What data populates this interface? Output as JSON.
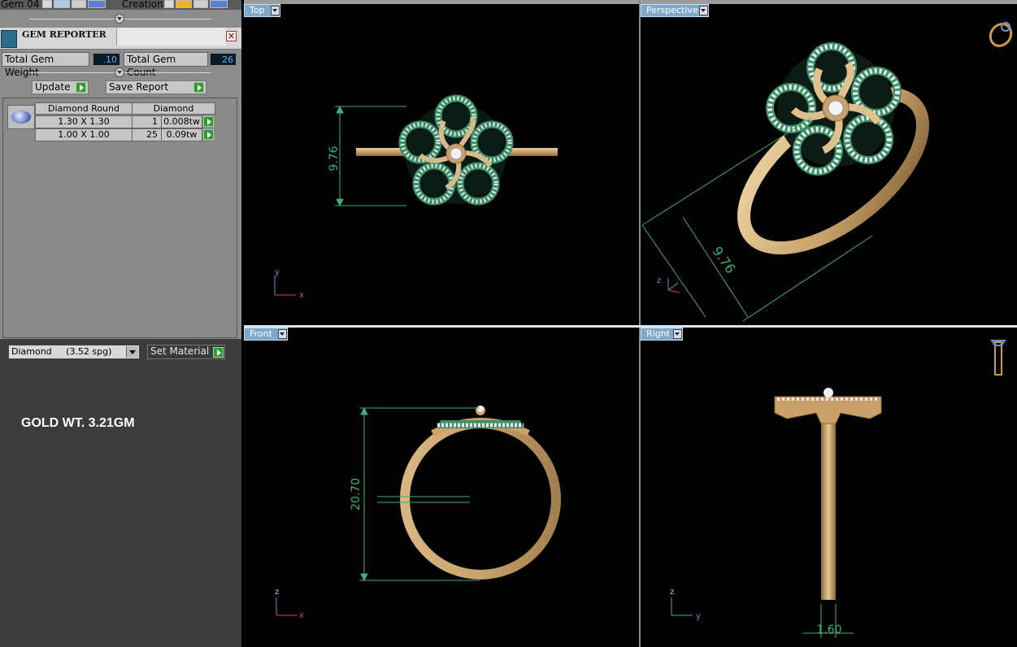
{
  "toolbar": {
    "gem_label": "Gem 04",
    "creation_label": "Creation"
  },
  "reporter": {
    "title": "GEM REPORTER",
    "close": "✕",
    "total_weight_label": "Total Gem Weight",
    "total_weight_value": ".10",
    "total_count_label": "Total Gem Count",
    "total_count_value": "26",
    "update_label": "Update",
    "save_report_label": "Save Report",
    "table": {
      "headers": [
        "Diamond Round",
        "Diamond"
      ],
      "rows": [
        {
          "size": "1.30 X 1.30",
          "count": "1",
          "weight": "0.008tw"
        },
        {
          "size": "1.00 X 1.00",
          "count": "25",
          "weight": "0.09tw"
        }
      ]
    }
  },
  "material": {
    "selected": "Diamond     (3.52 spg)",
    "set_label": "Set Material"
  },
  "note": "GOLD WT. 3.21GM",
  "viewports": {
    "top": {
      "label": "Top",
      "dimension": "9.76"
    },
    "perspective": {
      "label": "Perspective",
      "dimension": "9.76"
    },
    "front": {
      "label": "Front",
      "dimension": "20.70"
    },
    "right": {
      "label": "Right",
      "dimension": "1.60"
    }
  },
  "axes": {
    "x": "x",
    "y": "y",
    "z": "z"
  },
  "colors": {
    "panel_gray": "#8c8c8c",
    "panel_dark": "#3c3c3c",
    "gold": "#c9a26b",
    "dimension_green": "#3fae77",
    "tab_blue": "#7fa8c9",
    "play_green": "#2f9a2f"
  }
}
